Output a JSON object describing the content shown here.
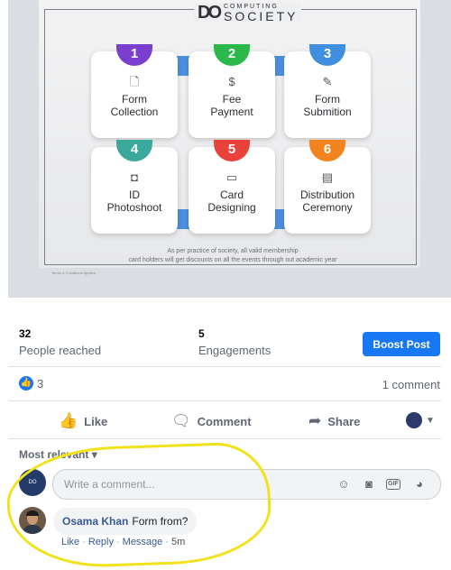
{
  "post_image": {
    "logo": {
      "mark": "DO",
      "small": "COMPUTING",
      "big": "SOCIETY"
    },
    "steps": [
      {
        "num": "1",
        "icon": "document-icon",
        "label": "Form\nCollection",
        "color": "#7b3fcf"
      },
      {
        "num": "2",
        "icon": "dollar-icon",
        "label": "Fee\nPayment",
        "color": "#2bb84a"
      },
      {
        "num": "3",
        "icon": "form-icon",
        "label": "Form\nSubmition",
        "color": "#3f8fde"
      },
      {
        "num": "4",
        "icon": "camera-icon",
        "label": "ID\nPhotoshoot",
        "color": "#3aa89a"
      },
      {
        "num": "5",
        "icon": "monitor-icon",
        "label": "Card\nDesigning",
        "color": "#e8423b"
      },
      {
        "num": "6",
        "icon": "certificate-icon",
        "label": "Distribution\nCeremony",
        "color": "#f2831f"
      }
    ],
    "footnote": "As per practice of society, all valid membership\ncard holders will get discounts on all the events through out academic year",
    "terms": "Terms & Conditions Applied"
  },
  "stats": {
    "reached_value": "32",
    "reached_label": "People reached",
    "engagement_value": "5",
    "engagement_label": "Engagements",
    "boost_label": "Boost Post"
  },
  "reactions": {
    "like_count": "3",
    "comments": "1 comment"
  },
  "actions": {
    "like": "Like",
    "comment": "Comment",
    "share": "Share"
  },
  "comments": {
    "sort_label": "Most relevant ▾",
    "placeholder": "Write a comment...",
    "page_avatar_text": "DO",
    "items": [
      {
        "author": "Osama Khan",
        "text": "Form from?",
        "like": "Like",
        "reply": "Reply",
        "message": "Message",
        "time": "5m"
      }
    ]
  },
  "colors": {
    "accent": "#1877f2",
    "highlight": "#f0e31d",
    "link": "#385898"
  }
}
